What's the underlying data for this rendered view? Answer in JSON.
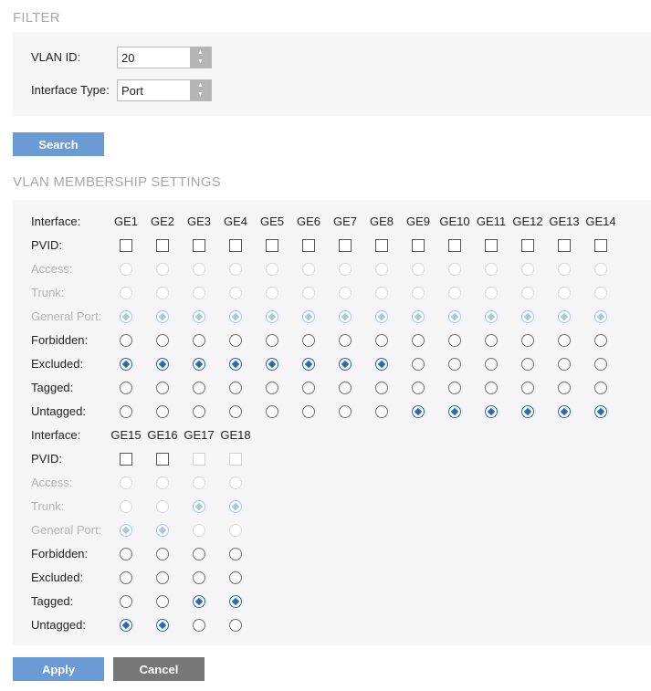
{
  "filter": {
    "title": "FILTER",
    "vlan_id_label": "VLAN ID:",
    "vlan_id_value": "20",
    "interface_type_label": "Interface Type:",
    "interface_type_value": "Port",
    "search_label": "Search"
  },
  "membership": {
    "title": "VLAN MEMBERSHIP SETTINGS",
    "interface_label": "Interface:",
    "row_labels": [
      "PVID:",
      "Access:",
      "Trunk:",
      "General Port:",
      "Forbidden:",
      "Excluded:",
      "Tagged:",
      "Untagged:"
    ],
    "groups": [
      {
        "ports": [
          {
            "name": "GE1",
            "pvid": false,
            "pvid_enabled": true,
            "mode": "general",
            "membership": "excluded",
            "member_enabled": true
          },
          {
            "name": "GE2",
            "pvid": false,
            "pvid_enabled": true,
            "mode": "general",
            "membership": "excluded",
            "member_enabled": true
          },
          {
            "name": "GE3",
            "pvid": false,
            "pvid_enabled": true,
            "mode": "general",
            "membership": "excluded",
            "member_enabled": true
          },
          {
            "name": "GE4",
            "pvid": false,
            "pvid_enabled": true,
            "mode": "general",
            "membership": "excluded",
            "member_enabled": true
          },
          {
            "name": "GE5",
            "pvid": false,
            "pvid_enabled": true,
            "mode": "general",
            "membership": "excluded",
            "member_enabled": true
          },
          {
            "name": "GE6",
            "pvid": false,
            "pvid_enabled": true,
            "mode": "general",
            "membership": "excluded",
            "member_enabled": true
          },
          {
            "name": "GE7",
            "pvid": false,
            "pvid_enabled": true,
            "mode": "general",
            "membership": "excluded",
            "member_enabled": true
          },
          {
            "name": "GE8",
            "pvid": false,
            "pvid_enabled": true,
            "mode": "general",
            "membership": "excluded",
            "member_enabled": true
          },
          {
            "name": "GE9",
            "pvid": false,
            "pvid_enabled": true,
            "mode": "general",
            "membership": "untagged",
            "member_enabled": true
          },
          {
            "name": "GE10",
            "pvid": false,
            "pvid_enabled": true,
            "mode": "general",
            "membership": "untagged",
            "member_enabled": true
          },
          {
            "name": "GE11",
            "pvid": false,
            "pvid_enabled": true,
            "mode": "general",
            "membership": "untagged",
            "member_enabled": true
          },
          {
            "name": "GE12",
            "pvid": false,
            "pvid_enabled": true,
            "mode": "general",
            "membership": "untagged",
            "member_enabled": true
          },
          {
            "name": "GE13",
            "pvid": false,
            "pvid_enabled": true,
            "mode": "general",
            "membership": "untagged",
            "member_enabled": true
          },
          {
            "name": "GE14",
            "pvid": false,
            "pvid_enabled": true,
            "mode": "general",
            "membership": "untagged",
            "member_enabled": true
          }
        ]
      },
      {
        "ports": [
          {
            "name": "GE15",
            "pvid": false,
            "pvid_enabled": true,
            "mode": "general",
            "membership": "untagged",
            "member_enabled": true
          },
          {
            "name": "GE16",
            "pvid": false,
            "pvid_enabled": true,
            "mode": "general",
            "membership": "untagged",
            "member_enabled": true
          },
          {
            "name": "GE17",
            "pvid": false,
            "pvid_enabled": false,
            "mode": "trunk",
            "membership": "tagged",
            "member_enabled": true
          },
          {
            "name": "GE18",
            "pvid": false,
            "pvid_enabled": false,
            "mode": "trunk",
            "membership": "tagged",
            "member_enabled": true
          }
        ]
      }
    ]
  },
  "actions": {
    "apply_label": "Apply",
    "cancel_label": "Cancel"
  },
  "colors": {
    "button_primary": "#6b9bd5",
    "button_secondary": "#777777",
    "radio_selected": "#2f67b8",
    "panel_bg": "#f6f6f6"
  }
}
